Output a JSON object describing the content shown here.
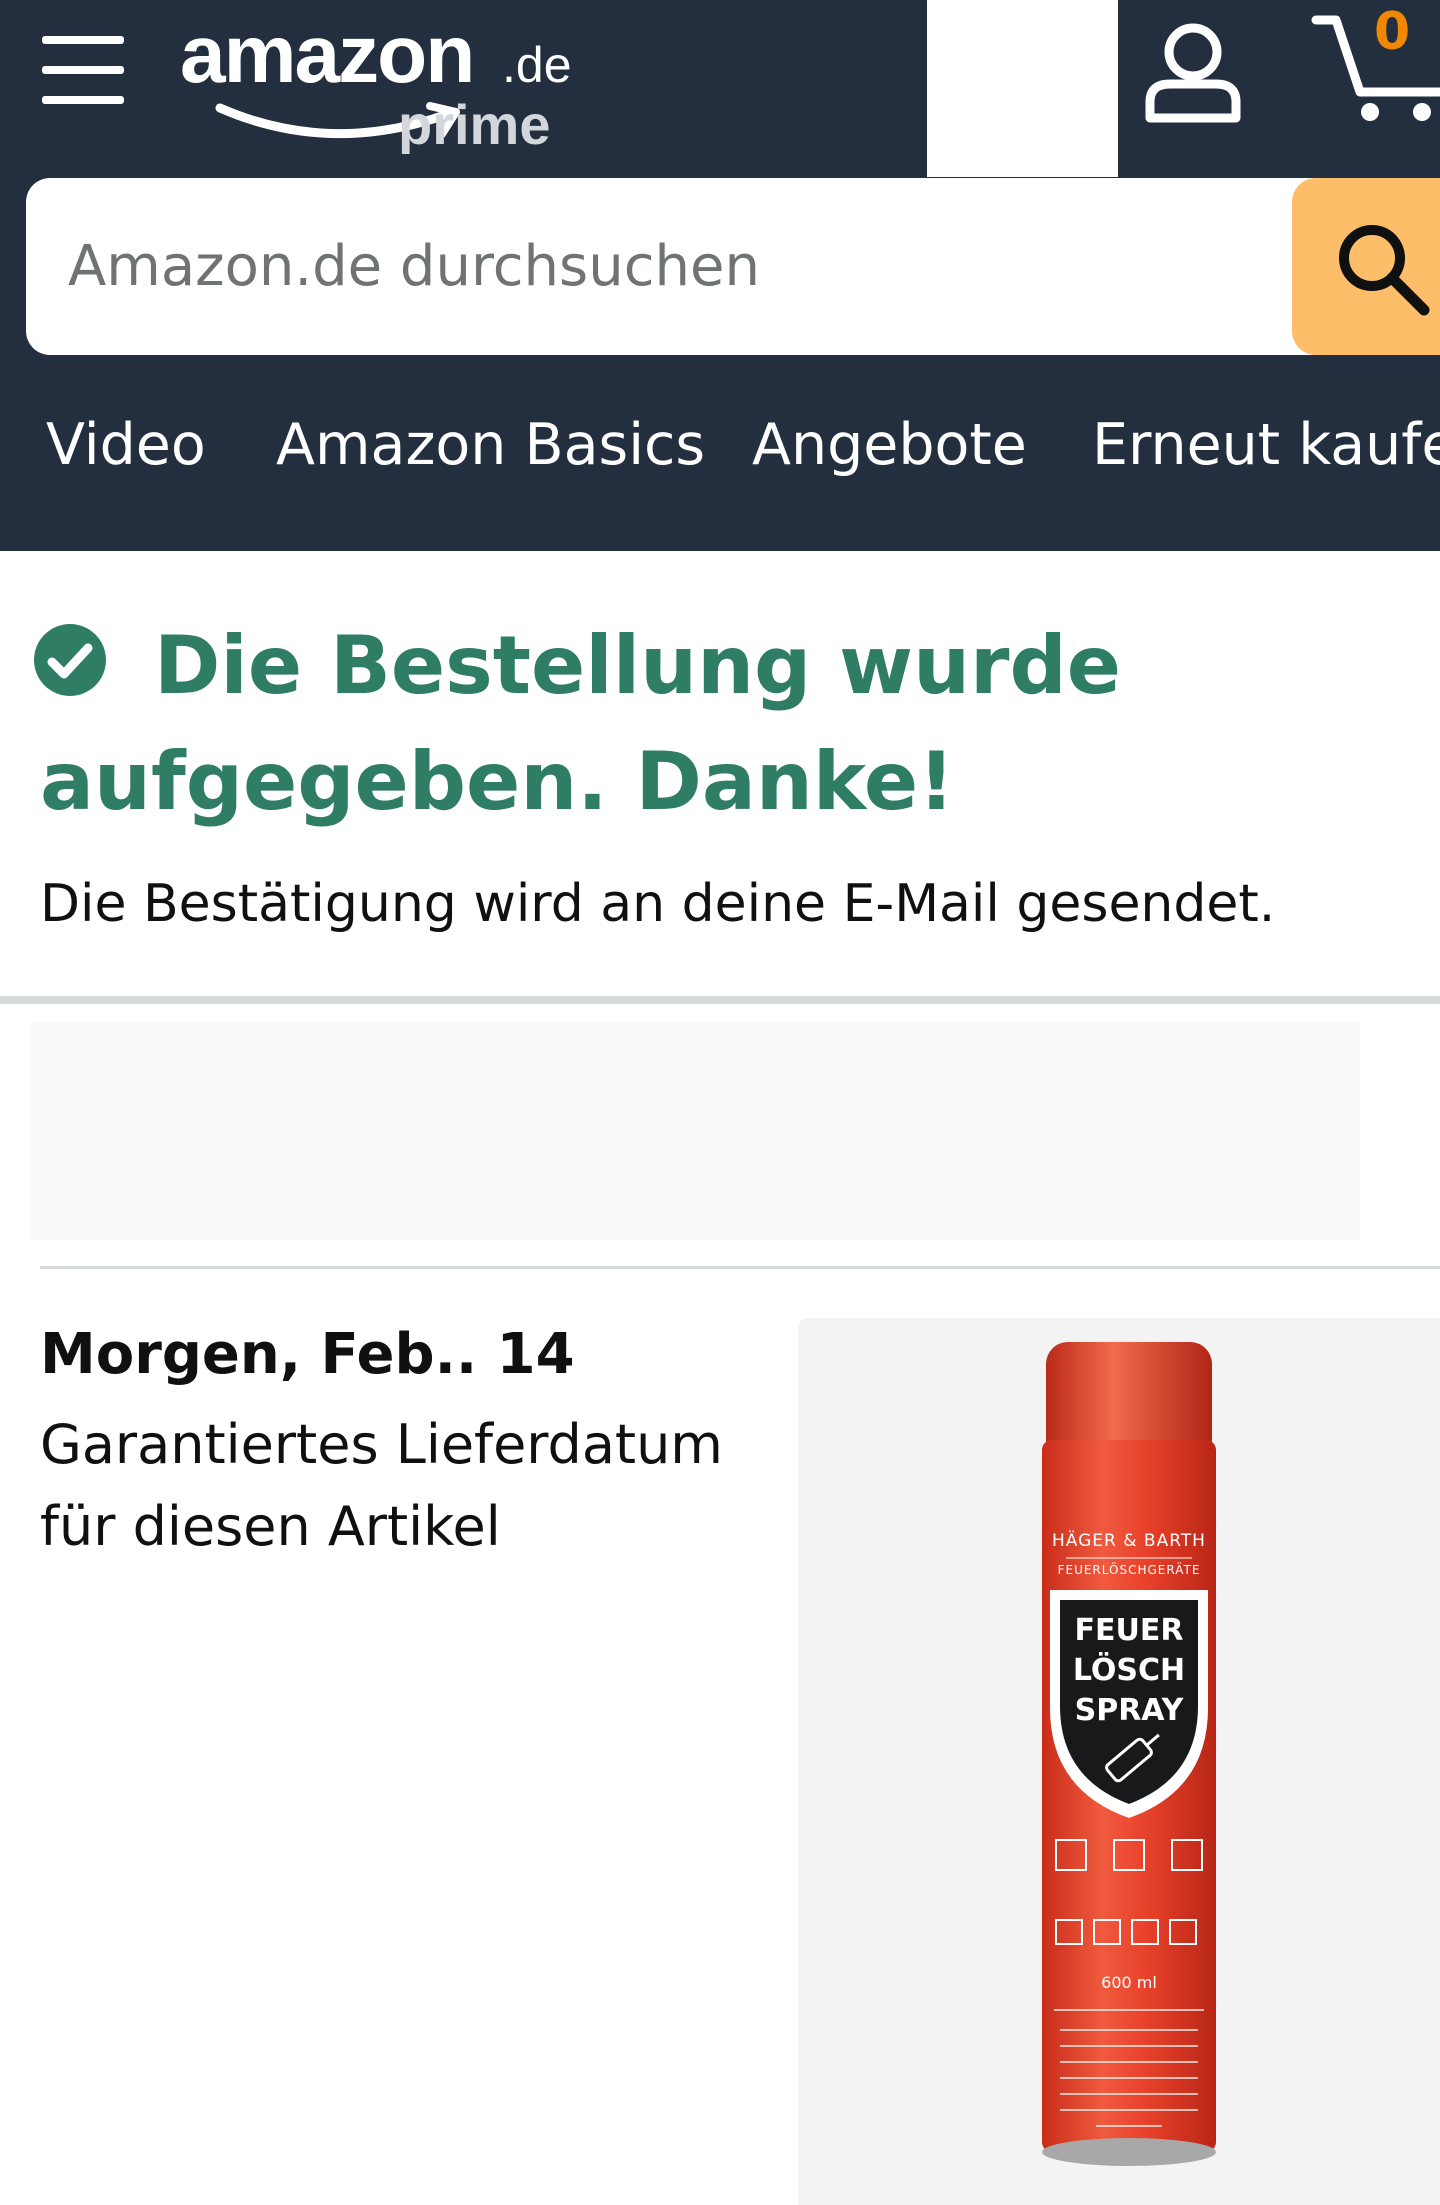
{
  "header": {
    "logo": {
      "wordmark": "amazon",
      "domain": ".de",
      "program": "prime"
    },
    "cart_count": "0",
    "icons": [
      "hamburger-menu-icon",
      "account-icon",
      "cart-icon",
      "search-icon"
    ]
  },
  "search": {
    "placeholder": "Amazon.de durchsuchen"
  },
  "nav": {
    "items": [
      "Video",
      "Amazon Basics",
      "Angebote",
      "Erneut kaufen"
    ]
  },
  "confirmation": {
    "title": "Die Bestellung wurde aufgegeben. Danke!",
    "subtitle": "Die Bestätigung wird an deine E-Mail gesendet."
  },
  "delivery": {
    "date": "Morgen, Feb.. 14",
    "note": "Garantiertes Lieferdatum für diesen Artikel"
  },
  "product": {
    "brand": "HÄGER & BARTH",
    "brand_sub": "FEUERLÖSCHGERÄTE",
    "label_lines": [
      "FEUER",
      "LÖSCH",
      "SPRAY"
    ],
    "volume": "600 ml"
  },
  "colors": {
    "header_bg": "#232f3e",
    "search_button": "#febd69",
    "cart_count": "#f08804",
    "success_green": "#2f7d64",
    "product_red": "#e8412a"
  }
}
